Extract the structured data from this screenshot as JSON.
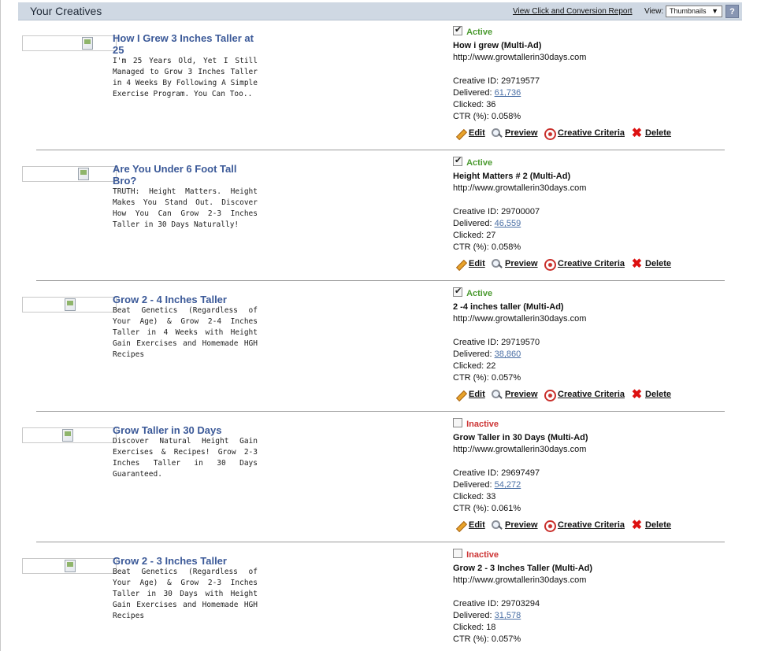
{
  "header": {
    "title": "Your Creatives",
    "report_link": "View Click and Conversion Report",
    "view_label": "View:",
    "view_selected": "Thumbnails",
    "help": "?"
  },
  "labels": {
    "creative_id": "Creative ID:",
    "delivered": "Delivered:",
    "clicked": "Clicked:",
    "ctr": "CTR (%):",
    "edit": "Edit",
    "preview": "Preview",
    "criteria": "Creative Criteria",
    "delete": "Delete"
  },
  "creatives": [
    {
      "title": "How I Grew 3 Inches Taller at 25",
      "description": "I'm 25 Years Old, Yet I Still Managed to Grow 3 Inches Taller in 4 Weeks By Following A Simple Exercise Program. You Can Too..",
      "checked": true,
      "status": "Active",
      "name": "How i grew (Multi-Ad)",
      "url": "http://www.growtallerin30days.com",
      "creative_id": "29719577",
      "delivered": "61,736",
      "clicked": "36",
      "ctr": "0.058%"
    },
    {
      "title": "Are You Under 6 Foot Tall Bro?",
      "description": "TRUTH: Height Matters. Height Makes You Stand Out. Discover How You Can Grow 2-3 Inches Taller in 30 Days Naturally!",
      "checked": true,
      "status": "Active",
      "name": "Height Matters # 2 (Multi-Ad)",
      "url": "http://www.growtallerin30days.com",
      "creative_id": "29700007",
      "delivered": "46,559",
      "clicked": "27",
      "ctr": "0.058%"
    },
    {
      "title": "Grow 2 - 4 Inches Taller",
      "description": "Beat Genetics (Regardless of Your Age) & Grow 2-4 Inches Taller in 4 Weeks with Height Gain Exercises and Homemade HGH Recipes",
      "checked": true,
      "status": "Active",
      "name": "2 -4 inches taller (Multi-Ad)",
      "url": "http://www.growtallerin30days.com",
      "creative_id": "29719570",
      "delivered": "38,860",
      "clicked": "22",
      "ctr": "0.057%"
    },
    {
      "title": "Grow Taller in 30 Days",
      "description": "Discover Natural Height Gain Exercises & Recipes! Grow 2-3 Inches Taller in 30 Days Guaranteed.",
      "checked": false,
      "status": "Inactive",
      "name": "Grow Taller in 30 Days (Multi-Ad)",
      "url": "http://www.growtallerin30days.com",
      "creative_id": "29697497",
      "delivered": "54,272",
      "clicked": "33",
      "ctr": "0.061%"
    },
    {
      "title": "Grow 2 - 3 Inches Taller",
      "description": "Beat Genetics (Regardless of Your Age) & Grow 2-3 Inches Taller in 30 Days with Height Gain Exercises and Homemade HGH Recipes",
      "checked": false,
      "status": "Inactive",
      "name": "Grow 2 - 3 Inches Taller (Multi-Ad)",
      "url": "http://www.growtallerin30days.com",
      "creative_id": "29703294",
      "delivered": "31,578",
      "clicked": "18",
      "ctr": "0.057%"
    }
  ]
}
